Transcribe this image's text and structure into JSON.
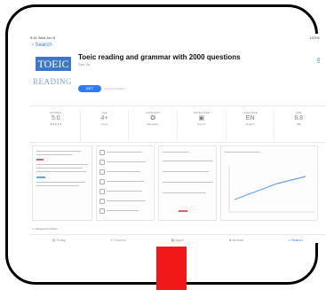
{
  "status_bar": {
    "time": "9:41 Wed Jun 5",
    "right": "100%"
  },
  "nav": {
    "back_label": "Search"
  },
  "app": {
    "logo_top": "TOEIC",
    "logo_bottom": "READING",
    "title": "Toeic reading and grammar with 2000 questions",
    "developer": "Duy Vu",
    "get_label": "GET",
    "in_app_note": "In-App Purchases"
  },
  "stats": [
    {
      "label": "RATINGS",
      "value": "5.0",
      "sub": "★★★★★"
    },
    {
      "label": "AGE",
      "value": "4+",
      "sub": "Years"
    },
    {
      "label": "CATEGORY",
      "value": "✪",
      "sub": "Education"
    },
    {
      "label": "DEVELOPER",
      "value": "▣",
      "sub": "Duy Vu"
    },
    {
      "label": "LANGUAGE",
      "value": "EN",
      "sub": "English"
    },
    {
      "label": "SIZE",
      "value": "6.8",
      "sub": "MB"
    }
  ],
  "compatibility": "Designed for iPad",
  "tabs": [
    {
      "label": "Today",
      "icon": "today-icon",
      "active": false
    },
    {
      "label": "Games",
      "icon": "games-icon",
      "active": false
    },
    {
      "label": "Apps",
      "icon": "apps-icon",
      "active": false
    },
    {
      "label": "Arcade",
      "icon": "arcade-icon",
      "active": false
    },
    {
      "label": "Search",
      "icon": "search-icon",
      "active": true
    }
  ],
  "colors": {
    "accent": "#2f7cf6",
    "logo_blue": "#3b78c9",
    "overlay_red": "#f01818"
  }
}
